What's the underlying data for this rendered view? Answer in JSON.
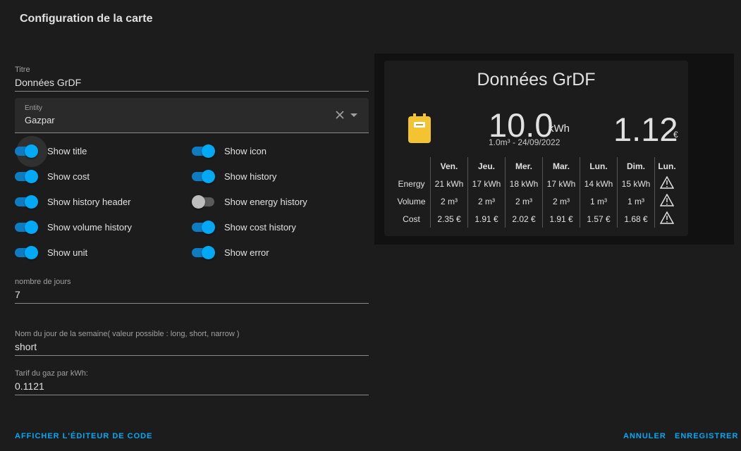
{
  "dialog": {
    "title": "Configuration de la carte"
  },
  "fields": {
    "titre": {
      "label": "Titre",
      "value": "Données GrDF"
    },
    "entity": {
      "label": "Entity",
      "value": "Gazpar"
    },
    "nombre_jours": {
      "label": "nombre de jours",
      "value": "7"
    },
    "nom_jour": {
      "label": "Nom du jour de la semaine( valeur possible : long, short, narrow )",
      "value": "short"
    },
    "tarif": {
      "label": "Tarif du gaz par kWh:",
      "value": "0.1121"
    }
  },
  "toggles": [
    {
      "label": "Show title",
      "on": true
    },
    {
      "label": "Show icon",
      "on": true
    },
    {
      "label": "Show cost",
      "on": true
    },
    {
      "label": "Show history",
      "on": true
    },
    {
      "label": "Show history header",
      "on": true
    },
    {
      "label": "Show energy history",
      "on": false
    },
    {
      "label": "Show volume history",
      "on": true
    },
    {
      "label": "Show cost history",
      "on": true
    },
    {
      "label": "Show unit",
      "on": true
    },
    {
      "label": "Show error",
      "on": true
    }
  ],
  "buttons": {
    "code_editor": "AFFICHER L'ÉDITEUR DE CODE",
    "cancel": "ANNULER",
    "save": "ENREGISTRER"
  },
  "card": {
    "title": "Données GrDF",
    "icon": "gas-meter-icon",
    "energy_value": "10.0",
    "energy_unit": "kWh",
    "subtitle": "1.0m³ - 24/09/2022",
    "cost_value": "1.12",
    "cost_unit": "€",
    "history": {
      "days": [
        "Ven.",
        "Jeu.",
        "Mer.",
        "Mar.",
        "Lun.",
        "Dim.",
        "Lun."
      ],
      "rows": [
        {
          "label": "Energy",
          "values": [
            "21 kWh",
            "17 kWh",
            "18 kWh",
            "17 kWh",
            "14 kWh",
            "15 kWh"
          ]
        },
        {
          "label": "Volume",
          "values": [
            "2 m³",
            "2 m³",
            "2 m³",
            "2 m³",
            "1 m³",
            "1 m³"
          ]
        },
        {
          "label": "Cost",
          "values": [
            "2.35 €",
            "1.91 €",
            "2.02 €",
            "1.91 €",
            "1.57 €",
            "1.68 €"
          ]
        }
      ],
      "last_column_icon": "alert-icon"
    }
  },
  "colors": {
    "accent": "#03a9f4",
    "background": "#1c1c1c",
    "meter": "#f4c430"
  }
}
